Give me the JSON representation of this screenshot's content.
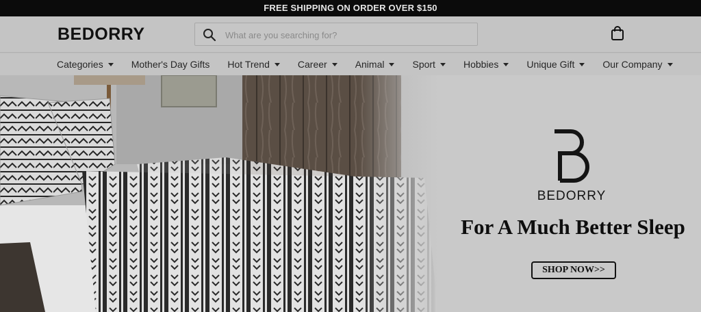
{
  "announcement": "FREE SHIPPING ON ORDER OVER $150",
  "header": {
    "logo": "BEDORRY",
    "search_placeholder": "What are you searching for?"
  },
  "nav": {
    "items": [
      {
        "label": "Categories",
        "dropdown": true
      },
      {
        "label": "Mother's Day Gifts",
        "dropdown": false
      },
      {
        "label": "Hot Trend",
        "dropdown": true
      },
      {
        "label": "Career",
        "dropdown": true
      },
      {
        "label": "Animal",
        "dropdown": true
      },
      {
        "label": "Sport",
        "dropdown": true
      },
      {
        "label": "Hobbies",
        "dropdown": true
      },
      {
        "label": "Unique Gift",
        "dropdown": true
      },
      {
        "label": "Our Company",
        "dropdown": true
      }
    ]
  },
  "hero": {
    "brand_name": "BEDORRY",
    "tagline": "For A Much Better Sleep",
    "cta": "SHOP NOW>>"
  },
  "icons": {
    "search": "search-icon",
    "cart": "shopping-bag-icon",
    "brand": "bedorry-logo-mark"
  }
}
